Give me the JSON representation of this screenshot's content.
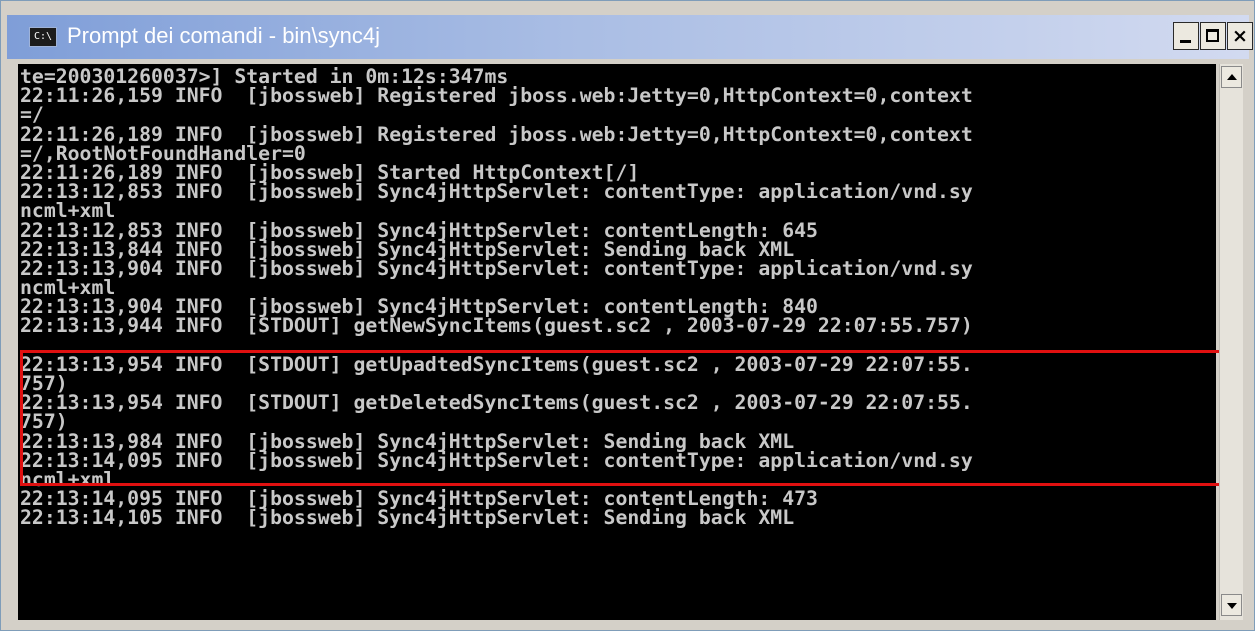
{
  "window": {
    "title": "Prompt dei comandi - bin\\sync4j",
    "icon": "cmd-icon",
    "icon_text": "C:\\",
    "minimize_icon": "minimize-icon",
    "maximize_icon": "maximize-icon",
    "close_icon": "close-icon",
    "close_glyph": "×"
  },
  "console": {
    "lines": [
      "te=200301260037>] Started in 0m:12s:347ms",
      "22:11:26,159 INFO  [jbossweb] Registered jboss.web:Jetty=0,HttpContext=0,context",
      "=/",
      "22:11:26,189 INFO  [jbossweb] Registered jboss.web:Jetty=0,HttpContext=0,context",
      "=/,RootNotFoundHandler=0",
      "22:11:26,189 INFO  [jbossweb] Started HttpContext[/]",
      "22:13:12,853 INFO  [jbossweb] Sync4jHttpServlet: contentType: application/vnd.sy",
      "ncml+xml",
      "22:13:12,853 INFO  [jbossweb] Sync4jHttpServlet: contentLength: 645",
      "22:13:13,844 INFO  [jbossweb] Sync4jHttpServlet: Sending back XML",
      "22:13:13,904 INFO  [jbossweb] Sync4jHttpServlet: contentType: application/vnd.sy",
      "ncml+xml",
      "22:13:13,904 INFO  [jbossweb] Sync4jHttpServlet: contentLength: 840",
      "22:13:13,944 INFO  [STDOUT] getNewSyncItems(guest.sc2 , 2003-07-29 22:07:55.757)",
      "",
      "22:13:13,954 INFO  [STDOUT] getUpadtedSyncItems(guest.sc2 , 2003-07-29 22:07:55.",
      "757)",
      "22:13:13,954 INFO  [STDOUT] getDeletedSyncItems(guest.sc2 , 2003-07-29 22:07:55.",
      "757)",
      "22:13:13,984 INFO  [jbossweb] Sync4jHttpServlet: Sending back XML",
      "22:13:14,095 INFO  [jbossweb] Sync4jHttpServlet: contentType: application/vnd.sy",
      "ncml+xml",
      "22:13:14,095 INFO  [jbossweb] Sync4jHttpServlet: contentLength: 473",
      "22:13:14,105 INFO  [jbossweb] Sync4jHttpServlet: Sending back XML"
    ],
    "text_color": "#c8c8c8",
    "background": "#000000"
  },
  "annotation": {
    "highlight_color": "#e01010"
  },
  "scrollbar": {
    "up_icon": "scroll-up-arrow-icon",
    "down_icon": "scroll-down-arrow-icon"
  }
}
